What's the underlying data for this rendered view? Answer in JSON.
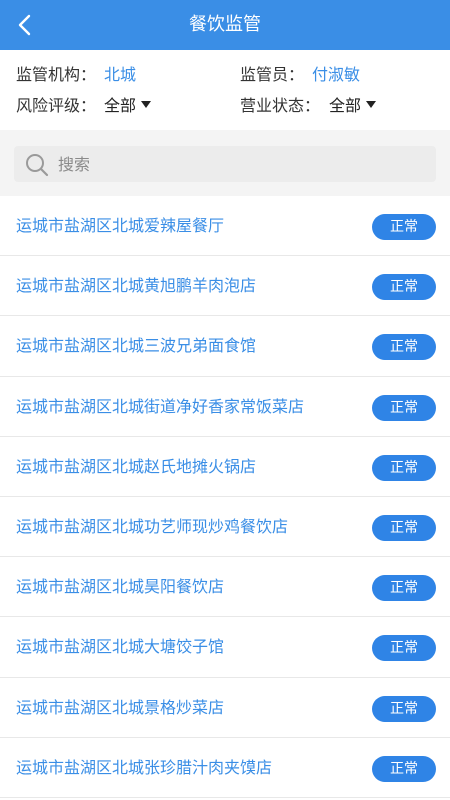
{
  "header": {
    "title": "餐饮监管",
    "back_icon": "back-arrow-icon"
  },
  "filters": {
    "agency_label": "监管机构：",
    "agency_value": "北城",
    "inspector_label": "监管员：",
    "inspector_value": "付淑敏",
    "risk_label": "风险评级：",
    "risk_value": "全部",
    "status_label": "营业状态：",
    "status_value": "全部"
  },
  "search": {
    "placeholder": "搜索",
    "icon": "search-icon"
  },
  "list": {
    "items": [
      {
        "name": "运城市盐湖区北城爱辣屋餐厅",
        "status": "正常"
      },
      {
        "name": "运城市盐湖区北城黄旭鹏羊肉泡店",
        "status": "正常"
      },
      {
        "name": "运城市盐湖区北城三波兄弟面食馆",
        "status": "正常"
      },
      {
        "name": "运城市盐湖区北城街道净好香家常饭菜店",
        "status": "正常"
      },
      {
        "name": "运城市盐湖区北城赵氏地摊火锅店",
        "status": "正常"
      },
      {
        "name": "运城市盐湖区北城功艺师现炒鸡餐饮店",
        "status": "正常"
      },
      {
        "name": "运城市盐湖区北城昊阳餐饮店",
        "status": "正常"
      },
      {
        "name": "运城市盐湖区北城大塘饺子馆",
        "status": "正常"
      },
      {
        "name": "运城市盐湖区北城景格炒菜店",
        "status": "正常"
      },
      {
        "name": "运城市盐湖区北城张珍腊汁肉夹馍店",
        "status": "正常"
      }
    ]
  },
  "colors": {
    "accent": "#3a8ee6",
    "badge": "#2f84e6"
  }
}
